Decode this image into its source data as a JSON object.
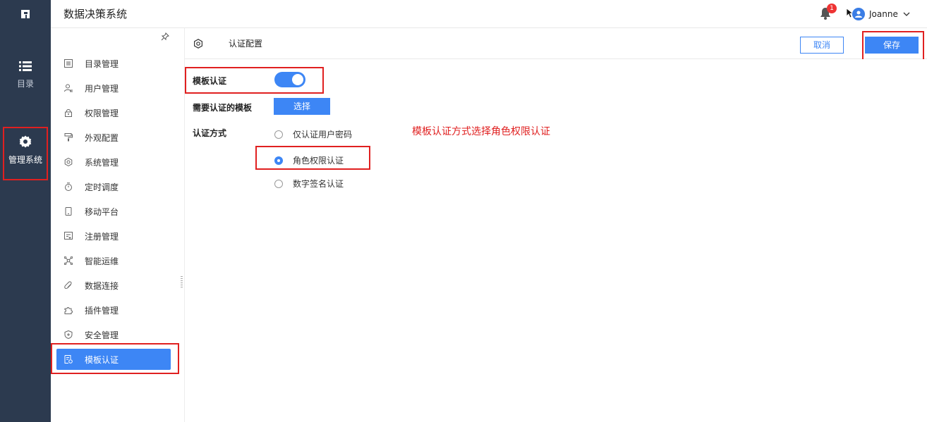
{
  "app": {
    "title": "数据决策系统"
  },
  "header": {
    "notification_count": "1",
    "user_name": "Joanne"
  },
  "rail": {
    "items": [
      {
        "label": "目录"
      },
      {
        "label": "管理系统"
      }
    ]
  },
  "sidebar": {
    "items": [
      {
        "label": "目录管理"
      },
      {
        "label": "用户管理"
      },
      {
        "label": "权限管理"
      },
      {
        "label": "外观配置"
      },
      {
        "label": "系统管理"
      },
      {
        "label": "定时调度"
      },
      {
        "label": "移动平台"
      },
      {
        "label": "注册管理"
      },
      {
        "label": "智能运维"
      },
      {
        "label": "数据连接"
      },
      {
        "label": "插件管理"
      },
      {
        "label": "安全管理"
      },
      {
        "label": "模板认证"
      }
    ]
  },
  "main": {
    "title": "认证配置",
    "cancel_label": "取消",
    "save_label": "保存",
    "template_auth_label": "模板认证",
    "template_auth_enabled": true,
    "templates_label": "需要认证的模板",
    "choose_label": "选择",
    "auth_method_label": "认证方式",
    "auth_options": [
      {
        "label": "仅认证用户密码",
        "checked": false
      },
      {
        "label": "角色权限认证",
        "checked": true
      },
      {
        "label": "数字签名认证",
        "checked": false
      }
    ],
    "annotation": "模板认证方式选择角色权限认证"
  },
  "colors": {
    "accent": "#3d86f5",
    "rail_bg": "#2c3a4f",
    "highlight": "#e02020"
  }
}
